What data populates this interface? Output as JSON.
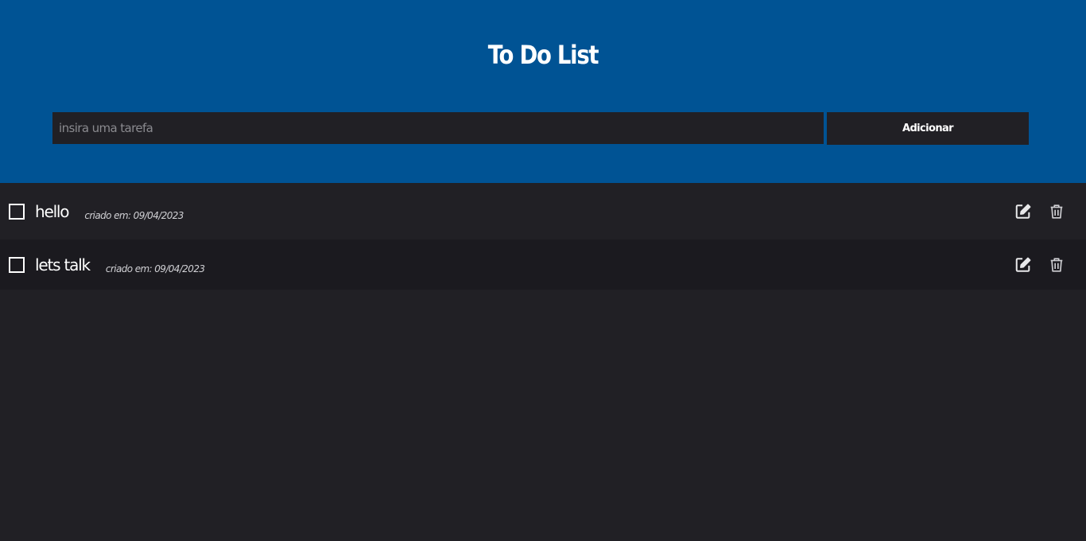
{
  "header": {
    "title": "To Do List",
    "input_placeholder": "insira uma tarefa",
    "add_button_label": "Adicionar"
  },
  "tasks": [
    {
      "text": "hello",
      "created_label": "criado em: 09/04/2023",
      "checked": false
    },
    {
      "text": "lets talk",
      "created_label": "criado em: 09/04/2023",
      "checked": false
    }
  ],
  "icons": {
    "checkbox": "checkbox-icon",
    "edit": "edit-icon",
    "delete": "trash-icon"
  },
  "colors": {
    "header_bg": "#005394",
    "page_bg": "#212025",
    "alt_row_bg": "#1b1a1f",
    "text": "#ffffff"
  }
}
